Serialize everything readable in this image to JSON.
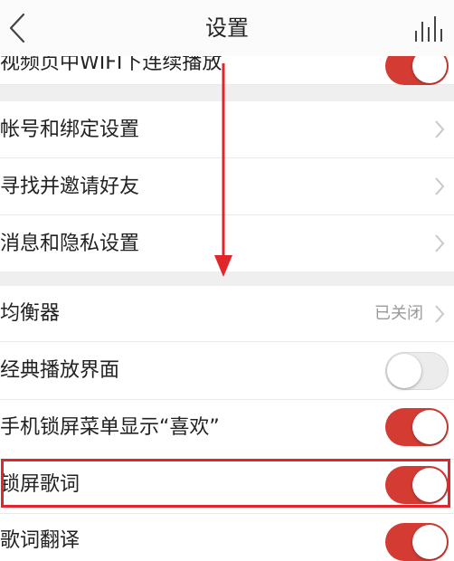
{
  "header": {
    "title": "设置"
  },
  "rows": [
    {
      "id": "video-wifi",
      "label": "视频页中WIFI下连续播放",
      "toggle": "on"
    },
    {
      "id": "account",
      "label": "帐号和绑定设置"
    },
    {
      "id": "invite",
      "label": "寻找并邀请好友"
    },
    {
      "id": "privacy",
      "label": "消息和隐私设置"
    },
    {
      "id": "equalizer",
      "label": "均衡器",
      "value": "已关闭"
    },
    {
      "id": "classic-player",
      "label": "经典播放界面",
      "toggle": "off"
    },
    {
      "id": "lockscreen-like",
      "label": "手机锁屏菜单显示“喜欢”",
      "toggle": "on"
    },
    {
      "id": "lockscreen-lyrics",
      "label": "锁屏歌词",
      "toggle": "on"
    },
    {
      "id": "lyrics-translation",
      "label": "歌词翻译",
      "toggle": "on"
    }
  ],
  "colors": {
    "accent": "#d43c33",
    "highlight": "#e0252b",
    "section_gap": "#efeff0"
  }
}
